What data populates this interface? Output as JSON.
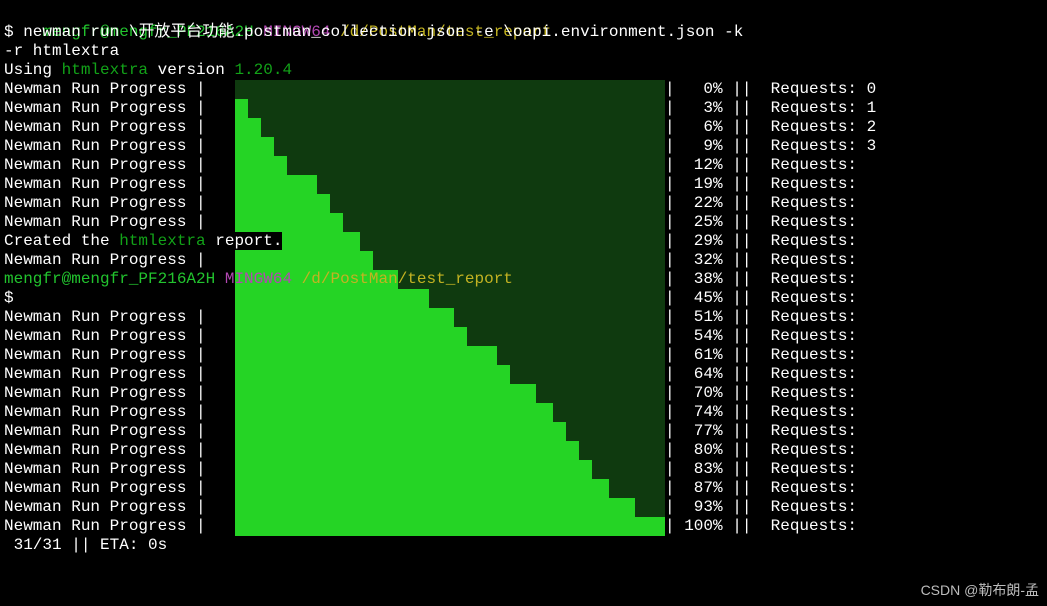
{
  "prompt1": {
    "user": "mengfr@mengfr_PF216A2H",
    "env": "MINGW64",
    "path": "/d/PostMan/test_report"
  },
  "cmd": {
    "p": "$ ",
    "t1": "newman run \\开放平台功能.postman_collection.json -e \\oapi.environment.json -k",
    "t2": "-r htmlextra"
  },
  "using": {
    "a": "Using ",
    "b": "htmlextra",
    "c": " version ",
    "d": "1.20.4"
  },
  "label": "Newman Run Progress |",
  "pipe": "|",
  "dpipe": "||",
  "req": "Requests:",
  "rows": [
    {
      "pct": "0%",
      "r": "0",
      "fill": 0
    },
    {
      "pct": "3%",
      "r": "1",
      "fill": 3
    },
    {
      "pct": "6%",
      "r": "2",
      "fill": 6
    },
    {
      "pct": "9%",
      "r": "3",
      "fill": 9
    },
    {
      "pct": "12%",
      "r": "",
      "fill": 12
    },
    {
      "pct": "19%",
      "r": "",
      "fill": 19
    },
    {
      "pct": "22%",
      "r": "",
      "fill": 22
    },
    {
      "pct": "25%",
      "r": "",
      "fill": 25
    },
    {
      "pct": "29%",
      "r": "",
      "fill": 29,
      "overlay": "created"
    },
    {
      "pct": "32%",
      "r": "",
      "fill": 32,
      "overlay": "progress"
    },
    {
      "pct": "38%",
      "r": "",
      "fill": 38,
      "overlay": "prompt2"
    },
    {
      "pct": "45%",
      "r": "",
      "fill": 45,
      "overlay": "dollar"
    },
    {
      "pct": "51%",
      "r": "",
      "fill": 51
    },
    {
      "pct": "54%",
      "r": "",
      "fill": 54
    },
    {
      "pct": "61%",
      "r": "",
      "fill": 61
    },
    {
      "pct": "64%",
      "r": "",
      "fill": 64
    },
    {
      "pct": "70%",
      "r": "",
      "fill": 70
    },
    {
      "pct": "74%",
      "r": "",
      "fill": 74
    },
    {
      "pct": "77%",
      "r": "",
      "fill": 77
    },
    {
      "pct": "80%",
      "r": "",
      "fill": 80
    },
    {
      "pct": "83%",
      "r": "",
      "fill": 83
    },
    {
      "pct": "87%",
      "r": "",
      "fill": 87
    },
    {
      "pct": "93%",
      "r": "",
      "fill": 93
    },
    {
      "pct": "100%",
      "r": "",
      "fill": 100
    }
  ],
  "created": {
    "a": "Created the ",
    "b": "htmlextra",
    "c": " report."
  },
  "footer": " 31/31 || ETA: 0s",
  "watermark": "CSDN @勒布朗-孟",
  "colors": {
    "bg": "#000000",
    "barFill": "#25d425",
    "barBack": "#0f3a0f",
    "green": "#22c32e",
    "magenta": "#b348b3",
    "yellow": "#c3b322"
  }
}
